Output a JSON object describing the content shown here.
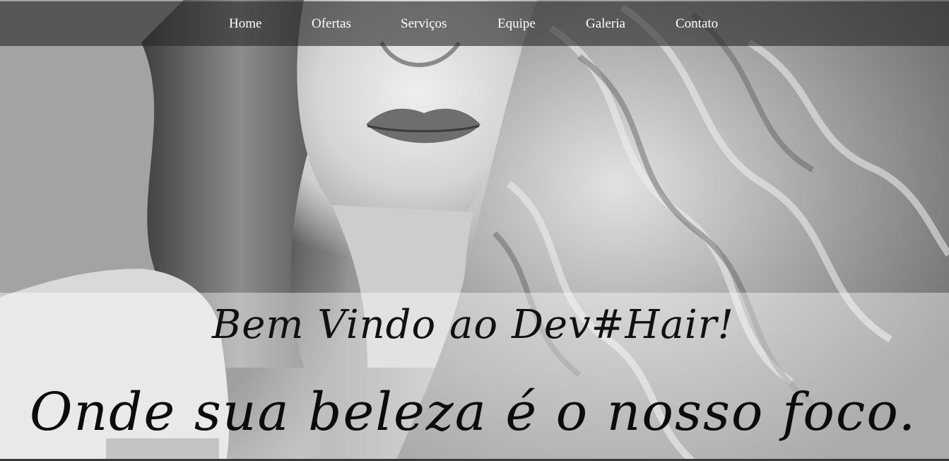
{
  "nav": {
    "items": [
      {
        "label": "Home"
      },
      {
        "label": "Ofertas"
      },
      {
        "label": "Serviços"
      },
      {
        "label": "Equipe"
      },
      {
        "label": "Galeria"
      },
      {
        "label": "Contato"
      }
    ]
  },
  "hero": {
    "title": "Bem Vindo ao Dev#Hair!",
    "tagline": "Onde sua beleza é o nosso foco."
  },
  "colors": {
    "navbar_bg": "#282828",
    "nav_text": "#ffffff",
    "heading_text": "#111111"
  }
}
